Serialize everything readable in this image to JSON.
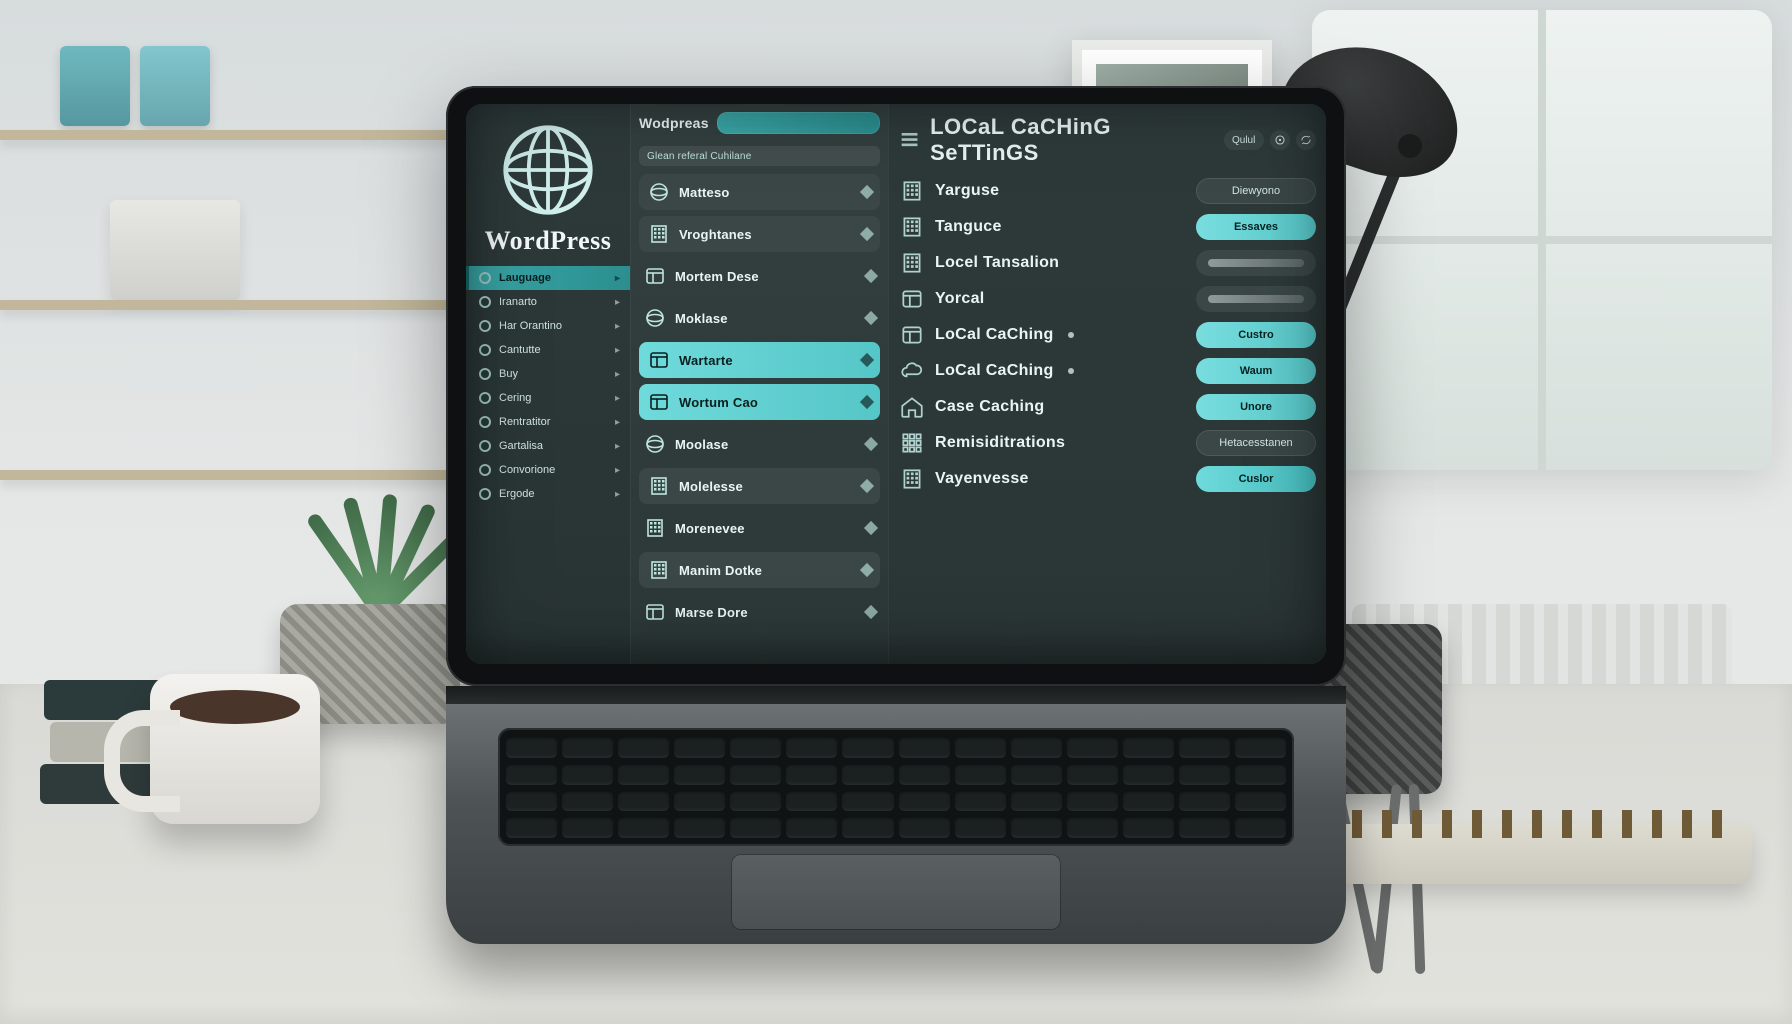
{
  "brand": {
    "name": "WordPress",
    "header_small": "Wodpreas"
  },
  "rail": {
    "items": [
      {
        "label": "Lauguage",
        "active": true
      },
      {
        "label": "Iranarto"
      },
      {
        "label": "Har Orantino"
      },
      {
        "label": "Cantutte"
      },
      {
        "label": "Buy"
      },
      {
        "label": "Cering"
      },
      {
        "label": "Rentratitor"
      },
      {
        "label": "Gartalisa"
      },
      {
        "label": "Convorione"
      },
      {
        "label": "Ergode"
      }
    ]
  },
  "mid": {
    "hint": "Glean referal Cuhilane",
    "items": [
      {
        "label": "Matteso",
        "variant": "row"
      },
      {
        "label": "Vroghtanes",
        "variant": "row"
      },
      {
        "label": "Mortem Dese",
        "variant": "flat"
      },
      {
        "label": "Moklase",
        "variant": "flat"
      },
      {
        "label": "Wartarte",
        "variant": "selected"
      },
      {
        "label": "Wortum Cao",
        "variant": "selected"
      },
      {
        "label": "Moolase",
        "variant": "flat"
      },
      {
        "label": "Molelesse",
        "variant": "row"
      },
      {
        "label": "Morenevee",
        "variant": "flat"
      },
      {
        "label": "Manim Dotke",
        "variant": "row"
      },
      {
        "label": "Marse Dore",
        "variant": "flat"
      }
    ]
  },
  "content": {
    "title": "LOCaL CaCHinG SeTTinGS",
    "header_actions": [
      {
        "label": "Qulul",
        "kind": "chip"
      },
      {
        "icon": "target",
        "kind": "round"
      },
      {
        "icon": "refresh",
        "kind": "round"
      }
    ],
    "rows": [
      {
        "icon": "building",
        "label": "Yarguse",
        "control": {
          "type": "field",
          "text": "Diewyono"
        }
      },
      {
        "icon": "building",
        "label": "Tanguce",
        "control": {
          "type": "accent",
          "text": "Essaves"
        }
      },
      {
        "icon": "building",
        "label": "Locel Tansalion",
        "control": {
          "type": "bar"
        }
      },
      {
        "icon": "panel",
        "label": "Yorcal",
        "control": {
          "type": "bar"
        }
      },
      {
        "icon": "panel",
        "label": "LoCal CaChing",
        "has_dot": true,
        "control": {
          "type": "accent",
          "text": "Custro"
        }
      },
      {
        "icon": "cloud",
        "label": "LoCal CaChing",
        "has_dot": true,
        "control": {
          "type": "accent",
          "text": "Waum"
        }
      },
      {
        "icon": "home",
        "label": "Case Caching",
        "control": {
          "type": "accent",
          "text": "Unore"
        }
      },
      {
        "icon": "grid",
        "label": "Remisiditrations",
        "control": {
          "type": "field",
          "text": "Hetacesstanen"
        }
      },
      {
        "icon": "building",
        "label": "Vayenvesse",
        "control": {
          "type": "accent-strong",
          "text": "Cuslor"
        }
      }
    ]
  },
  "colors": {
    "accent": "#5ecdd0",
    "panel": "#2e3a3a",
    "panel2": "#33403f",
    "text": "#e9f5f4"
  }
}
